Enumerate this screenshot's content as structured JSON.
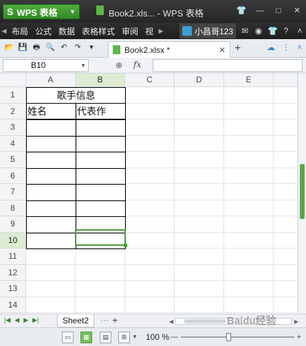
{
  "app": {
    "menu_button": "WPS 表格",
    "window_title": "Book2.xls... - WPS 表格"
  },
  "menubar": {
    "items": [
      "布局",
      "公式",
      "数据",
      "表格样式",
      "审阅",
      "视"
    ],
    "username": "小昌哥123"
  },
  "tabs": {
    "doc_tab": "Book2.xlsx *"
  },
  "formula_bar": {
    "name_box": "B10",
    "fx_label": "fx",
    "formula_value": ""
  },
  "grid": {
    "columns": [
      "A",
      "B",
      "C",
      "D",
      "E"
    ],
    "rows": [
      "1",
      "2",
      "3",
      "4",
      "5",
      "6",
      "7",
      "8",
      "9",
      "10",
      "11",
      "12",
      "13",
      "14"
    ],
    "selected_column": "B",
    "selected_row": "10",
    "merged_title": "歌手信息",
    "header_a": "姓名",
    "header_b": "代表作"
  },
  "sheets": {
    "active": "Sheet2",
    "more": "···"
  },
  "status": {
    "zoom": "100 %"
  },
  "watermark": "Baidu经验",
  "colors": {
    "accent_green": "#4a9b3a",
    "titlebar": "#2f2f2f",
    "header_selected": "#ddecd2"
  }
}
